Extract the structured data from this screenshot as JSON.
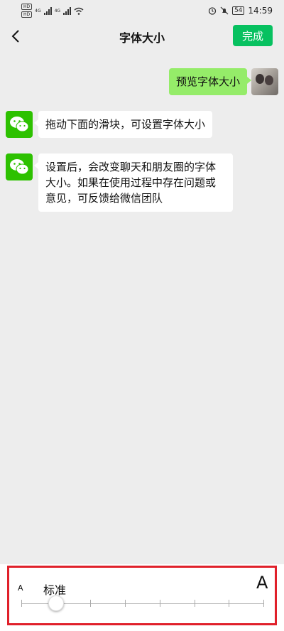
{
  "status_bar": {
    "hd1": "HD",
    "hd2": "HD",
    "net1": "4G",
    "net2": "4G",
    "battery": "54",
    "time": "14:59",
    "icons": [
      "signal-icon",
      "wifi-icon",
      "alarm-icon",
      "mute-icon",
      "battery-icon"
    ]
  },
  "nav": {
    "title": "字体大小",
    "done_label": "完成"
  },
  "messages": {
    "preview": "预览字体大小",
    "hint1": "拖动下面的滑块，可设置字体大小",
    "hint2": "设置后，会改变聊天和朋友圈的字体大小。如果在使用过程中存在问题或意见，可反馈给微信团队"
  },
  "font_slider": {
    "small_label": "A",
    "large_label": "A",
    "current_label": "标准",
    "steps": 8,
    "selected_step": 1
  },
  "colors": {
    "accent": "#07c160",
    "bubble_self": "#95ec69",
    "highlight": "#e0202a"
  }
}
